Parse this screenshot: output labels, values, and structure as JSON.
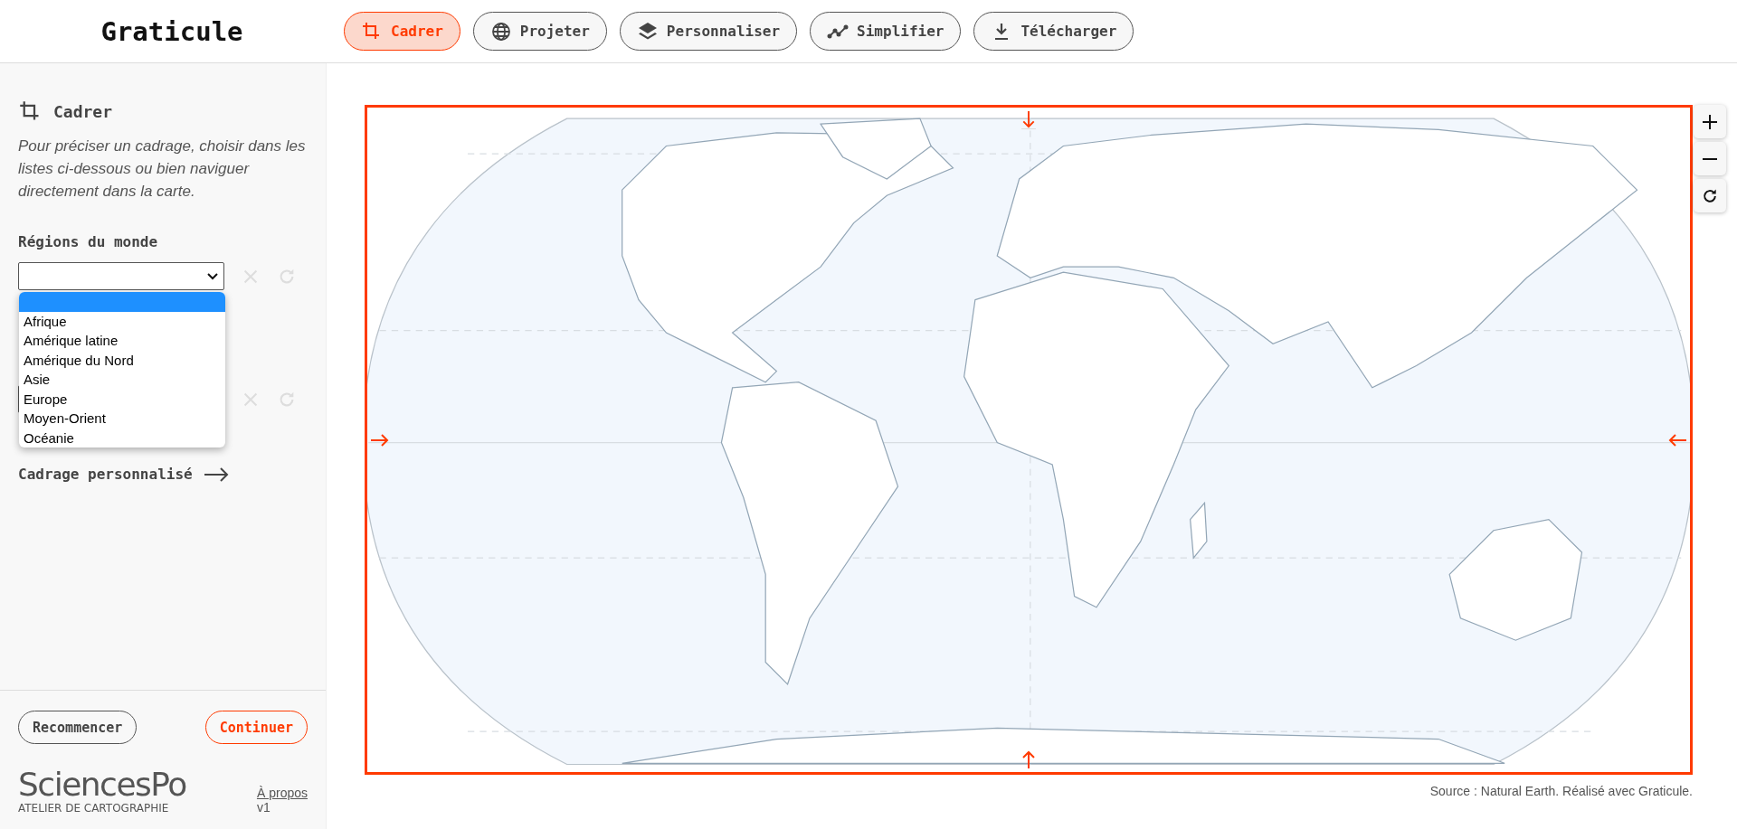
{
  "app": {
    "title": "Graticule"
  },
  "tabs": [
    {
      "label": "Cadrer",
      "selected": true
    },
    {
      "label": "Projeter",
      "selected": false
    },
    {
      "label": "Personnaliser",
      "selected": false
    },
    {
      "label": "Simplifier",
      "selected": false
    },
    {
      "label": "Télécharger",
      "selected": false
    }
  ],
  "panel": {
    "title": "Cadrer",
    "description": "Pour préciser un cadrage, choisir dans les listes ci-dessous ou bien naviguer directement dans la carte.",
    "region_field": {
      "label": "Régions du monde",
      "blank_option_highlighted": true,
      "options": [
        {
          "label": "Afrique",
          "selected": false
        },
        {
          "label": "Amérique latine",
          "selected": false
        },
        {
          "label": "Amérique du Nord",
          "selected": false
        },
        {
          "label": "Asie",
          "selected": false
        },
        {
          "label": "Europe",
          "selected": false
        },
        {
          "label": "Moyen-Orient",
          "selected": false
        },
        {
          "label": "Océanie",
          "selected": false
        }
      ]
    },
    "custom_link": "Cadrage personnalisé"
  },
  "footer": {
    "buttons": [
      {
        "label": "Recommencer",
        "kind": "secondary"
      },
      {
        "label": "Continuer",
        "kind": "primary"
      }
    ],
    "logo": {
      "name": "SciencesPo",
      "subtitle": "ATELIER DE CARTOGRAPHIE"
    },
    "about_link": "À propos",
    "version": "v1"
  },
  "map": {
    "source": "Source : Natural Earth. Réalisé avec Graticule."
  }
}
